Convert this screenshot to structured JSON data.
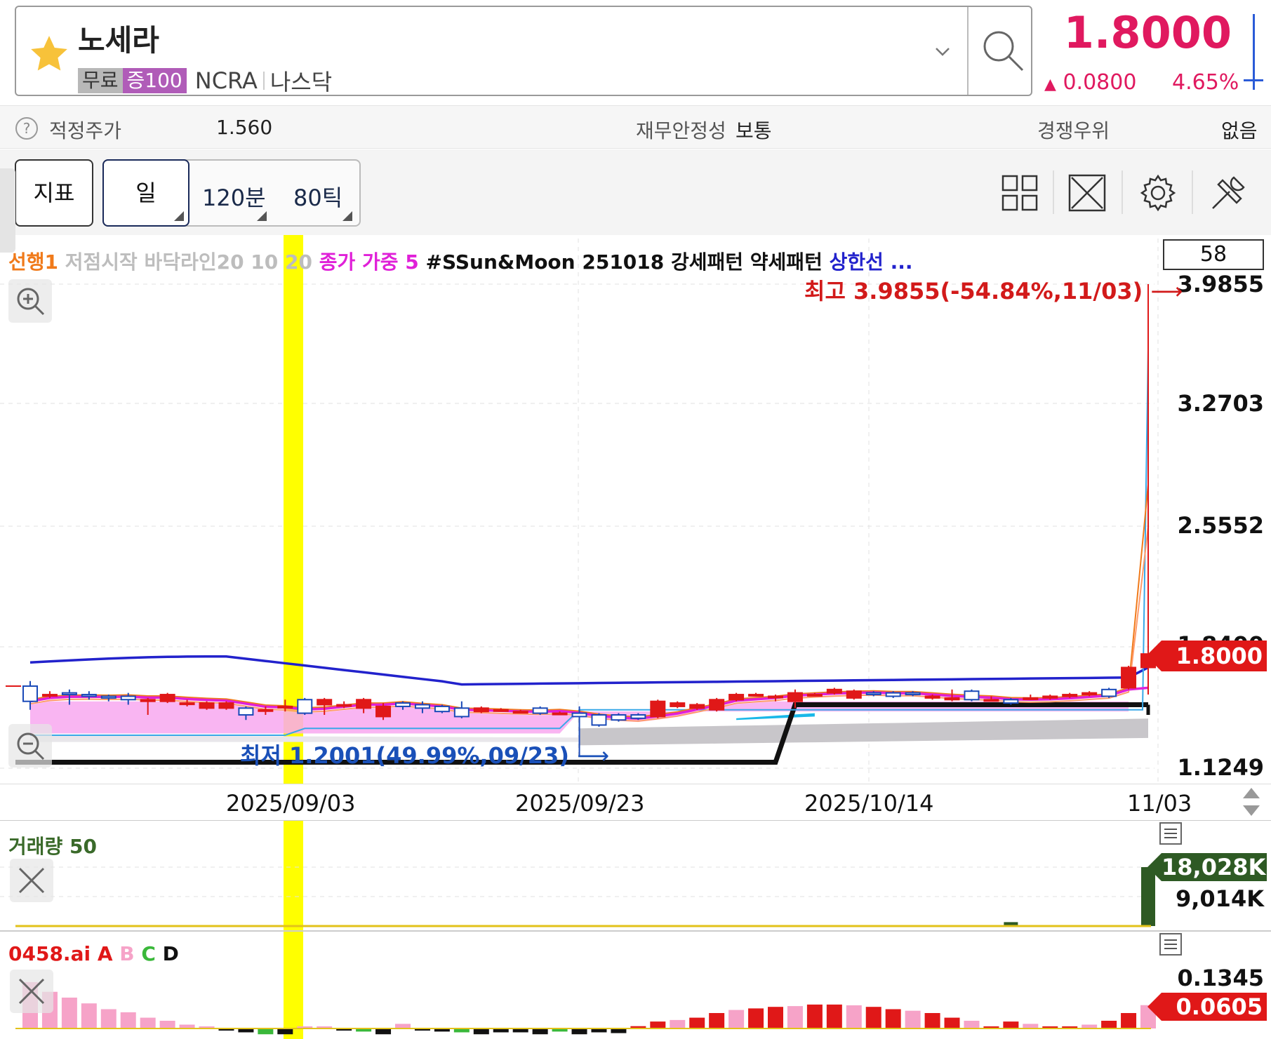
{
  "header": {
    "stock_name": "노세라",
    "tag_free": "무료",
    "tag_margin": "증100",
    "ticker": "NCRA",
    "exchange": "나스닥",
    "price": "1.8000",
    "change": "0.0800",
    "change_arrow": "▲",
    "change_pct": "4.65%",
    "icons": [
      "star-icon",
      "chevron-down-icon",
      "search-icon"
    ]
  },
  "info_bar": {
    "fair_price_label": "적정주가",
    "fair_price_value": "1.560",
    "stability_label": "재무안정성",
    "stability_value": "보통",
    "competitive_label": "경쟁우위",
    "competitive_value": "없음",
    "help_glyph": "?"
  },
  "toolbar": {
    "indicator": "지표",
    "day": "일",
    "min120": "120분",
    "tick80": "80틱",
    "tools": [
      "grid-layout-icon",
      "fullscreen-icon",
      "gear-icon",
      "tools-icon"
    ]
  },
  "chart": {
    "legend": [
      {
        "text": "선행1 ",
        "color": "#f07a1a"
      },
      {
        "text": "저점시작 바닥라인20 10 20 ",
        "color": "#bdbdbd"
      },
      {
        "text": "종가 가중 5 ",
        "color": "#e020d8"
      },
      {
        "text": "#SSun&Moon 251018 강세패턴 약세패턴 ",
        "color": "#111111"
      },
      {
        "text": "상한선 ...",
        "color": "#2222cc"
      }
    ],
    "period": "58",
    "y_labels": [
      "3.9855",
      "3.2703",
      "2.5552",
      "1.8400",
      "1.1249"
    ],
    "current_price_tag": "1.8000",
    "high_annotation": "최고 3.9855(-54.84%,11/03)",
    "low_annotation": "최저 1.2001(49.99%,09/23)",
    "x_labels": [
      "2025/09/03",
      "2025/09/23",
      "2025/10/14",
      "11/03"
    ]
  },
  "chart_data": {
    "type": "candlestick",
    "ylim": [
      1.1249,
      3.9855
    ],
    "high": 3.9855,
    "low": 1.2001,
    "last": 1.8,
    "candles": [
      {
        "o": 1.61,
        "c": 1.52,
        "h": 1.64,
        "l": 1.47
      },
      {
        "o": 1.56,
        "c": 1.56,
        "h": 1.58,
        "l": 1.54
      },
      {
        "o": 1.57,
        "c": 1.56,
        "h": 1.59,
        "l": 1.5
      },
      {
        "o": 1.56,
        "c": 1.55,
        "h": 1.58,
        "l": 1.53
      },
      {
        "o": 1.55,
        "c": 1.54,
        "h": 1.56,
        "l": 1.52
      },
      {
        "o": 1.55,
        "c": 1.53,
        "h": 1.57,
        "l": 1.5
      },
      {
        "o": 1.52,
        "c": 1.53,
        "h": 1.54,
        "l": 1.44
      },
      {
        "o": 1.52,
        "c": 1.56,
        "h": 1.57,
        "l": 1.51
      },
      {
        "o": 1.51,
        "c": 1.51,
        "h": 1.53,
        "l": 1.49
      },
      {
        "o": 1.48,
        "c": 1.51,
        "h": 1.52,
        "l": 1.47
      },
      {
        "o": 1.48,
        "c": 1.51,
        "h": 1.52,
        "l": 1.47
      },
      {
        "o": 1.48,
        "c": 1.44,
        "h": 1.49,
        "l": 1.41
      },
      {
        "o": 1.47,
        "c": 1.47,
        "h": 1.49,
        "l": 1.44
      },
      {
        "o": 1.49,
        "c": 1.49,
        "h": 1.53,
        "l": 1.46
      },
      {
        "o": 1.53,
        "c": 1.45,
        "h": 1.54,
        "l": 1.44
      },
      {
        "o": 1.5,
        "c": 1.53,
        "h": 1.54,
        "l": 1.44
      },
      {
        "o": 1.5,
        "c": 1.5,
        "h": 1.52,
        "l": 1.48
      },
      {
        "o": 1.48,
        "c": 1.53,
        "h": 1.54,
        "l": 1.45
      },
      {
        "o": 1.43,
        "c": 1.49,
        "h": 1.51,
        "l": 1.41
      },
      {
        "o": 1.51,
        "c": 1.49,
        "h": 1.52,
        "l": 1.47
      },
      {
        "o": 1.5,
        "c": 1.48,
        "h": 1.52,
        "l": 1.45
      },
      {
        "o": 1.49,
        "c": 1.46,
        "h": 1.5,
        "l": 1.45
      },
      {
        "o": 1.48,
        "c": 1.43,
        "h": 1.52,
        "l": 1.42
      },
      {
        "o": 1.46,
        "c": 1.48,
        "h": 1.49,
        "l": 1.45
      },
      {
        "o": 1.47,
        "c": 1.47,
        "h": 1.48,
        "l": 1.46
      },
      {
        "o": 1.46,
        "c": 1.46,
        "h": 1.47,
        "l": 1.45
      },
      {
        "o": 1.48,
        "c": 1.45,
        "h": 1.49,
        "l": 1.44
      },
      {
        "o": 1.45,
        "c": 1.45,
        "h": 1.46,
        "l": 1.44
      },
      {
        "o": 1.45,
        "c": 1.43,
        "h": 1.49,
        "l": 1.2
      },
      {
        "o": 1.44,
        "c": 1.38,
        "h": 1.45,
        "l": 1.37
      },
      {
        "o": 1.44,
        "c": 1.41,
        "h": 1.45,
        "l": 1.4
      },
      {
        "o": 1.44,
        "c": 1.42,
        "h": 1.45,
        "l": 1.41
      },
      {
        "o": 1.43,
        "c": 1.52,
        "h": 1.53,
        "l": 1.42
      },
      {
        "o": 1.49,
        "c": 1.51,
        "h": 1.52,
        "l": 1.48
      },
      {
        "o": 1.48,
        "c": 1.5,
        "h": 1.51,
        "l": 1.47
      },
      {
        "o": 1.47,
        "c": 1.53,
        "h": 1.54,
        "l": 1.46
      },
      {
        "o": 1.53,
        "c": 1.56,
        "h": 1.57,
        "l": 1.52
      },
      {
        "o": 1.56,
        "c": 1.56,
        "h": 1.57,
        "l": 1.55
      },
      {
        "o": 1.55,
        "c": 1.55,
        "h": 1.56,
        "l": 1.52
      },
      {
        "o": 1.52,
        "c": 1.57,
        "h": 1.59,
        "l": 1.48
      },
      {
        "o": 1.56,
        "c": 1.56,
        "h": 1.57,
        "l": 1.55
      },
      {
        "o": 1.57,
        "c": 1.59,
        "h": 1.6,
        "l": 1.56
      },
      {
        "o": 1.54,
        "c": 1.58,
        "h": 1.59,
        "l": 1.53
      },
      {
        "o": 1.57,
        "c": 1.56,
        "h": 1.58,
        "l": 1.55
      },
      {
        "o": 1.57,
        "c": 1.55,
        "h": 1.58,
        "l": 1.54
      },
      {
        "o": 1.57,
        "c": 1.56,
        "h": 1.58,
        "l": 1.55
      },
      {
        "o": 1.54,
        "c": 1.55,
        "h": 1.56,
        "l": 1.53
      },
      {
        "o": 1.53,
        "c": 1.54,
        "h": 1.59,
        "l": 1.52
      },
      {
        "o": 1.58,
        "c": 1.53,
        "h": 1.59,
        "l": 1.52
      },
      {
        "o": 1.53,
        "c": 1.53,
        "h": 1.55,
        "l": 1.52
      },
      {
        "o": 1.53,
        "c": 1.51,
        "h": 1.54,
        "l": 1.5
      },
      {
        "o": 1.54,
        "c": 1.54,
        "h": 1.56,
        "l": 1.53
      },
      {
        "o": 1.54,
        "c": 1.55,
        "h": 1.56,
        "l": 1.53
      },
      {
        "o": 1.55,
        "c": 1.56,
        "h": 1.57,
        "l": 1.54
      },
      {
        "o": 1.56,
        "c": 1.57,
        "h": 1.58,
        "l": 1.55
      },
      {
        "o": 1.59,
        "c": 1.55,
        "h": 1.6,
        "l": 1.54
      },
      {
        "o": 1.6,
        "c": 1.72,
        "h": 1.73,
        "l": 1.59
      },
      {
        "o": 1.72,
        "c": 1.8,
        "h": 3.9855,
        "l": 1.56
      }
    ],
    "volume_series_name": "거래량 50",
    "volume_labels": [
      "18,028K",
      "9,014K"
    ],
    "volume_max": 18028,
    "volume": [
      60,
      40,
      30,
      30,
      20,
      20,
      30,
      30,
      20,
      20,
      20,
      20,
      30,
      20,
      20,
      20,
      30,
      20,
      30,
      20,
      20,
      20,
      20,
      20,
      20,
      20,
      20,
      20,
      40,
      30,
      20,
      20,
      40,
      30,
      20,
      20,
      20,
      30,
      20,
      20,
      20,
      30,
      20,
      20,
      20,
      20,
      20,
      30,
      20,
      20,
      1200,
      300,
      20,
      20,
      30,
      20,
      20,
      18028
    ],
    "ai_series_name": "0458.ai",
    "ai_legend": [
      {
        "text": "A",
        "color": "#e01818"
      },
      {
        "text": "B",
        "color": "#f6a3c8"
      },
      {
        "text": "C",
        "color": "#3ab83a"
      },
      {
        "text": "D",
        "color": "#111111"
      }
    ],
    "ai_labels": [
      "0.1345",
      "0.0605"
    ],
    "ai_values": [
      0.12,
      0.095,
      0.08,
      0.065,
      0.05,
      0.042,
      0.028,
      0.02,
      0.01,
      0.005,
      -0.005,
      -0.01,
      -0.015,
      -0.015,
      0.002,
      0.003,
      -0.003,
      -0.008,
      -0.015,
      0.012,
      -0.005,
      -0.008,
      -0.01,
      -0.015,
      -0.01,
      -0.01,
      -0.015,
      -0.008,
      -0.015,
      -0.01,
      -0.012,
      0.006,
      0.018,
      0.022,
      0.028,
      0.04,
      0.048,
      0.052,
      0.056,
      0.058,
      0.062,
      0.062,
      0.06,
      0.056,
      0.05,
      0.046,
      0.04,
      0.028,
      0.02,
      0.005,
      0.018,
      0.012,
      0.004,
      0.003,
      0.01,
      0.02,
      0.04,
      0.0605
    ]
  }
}
